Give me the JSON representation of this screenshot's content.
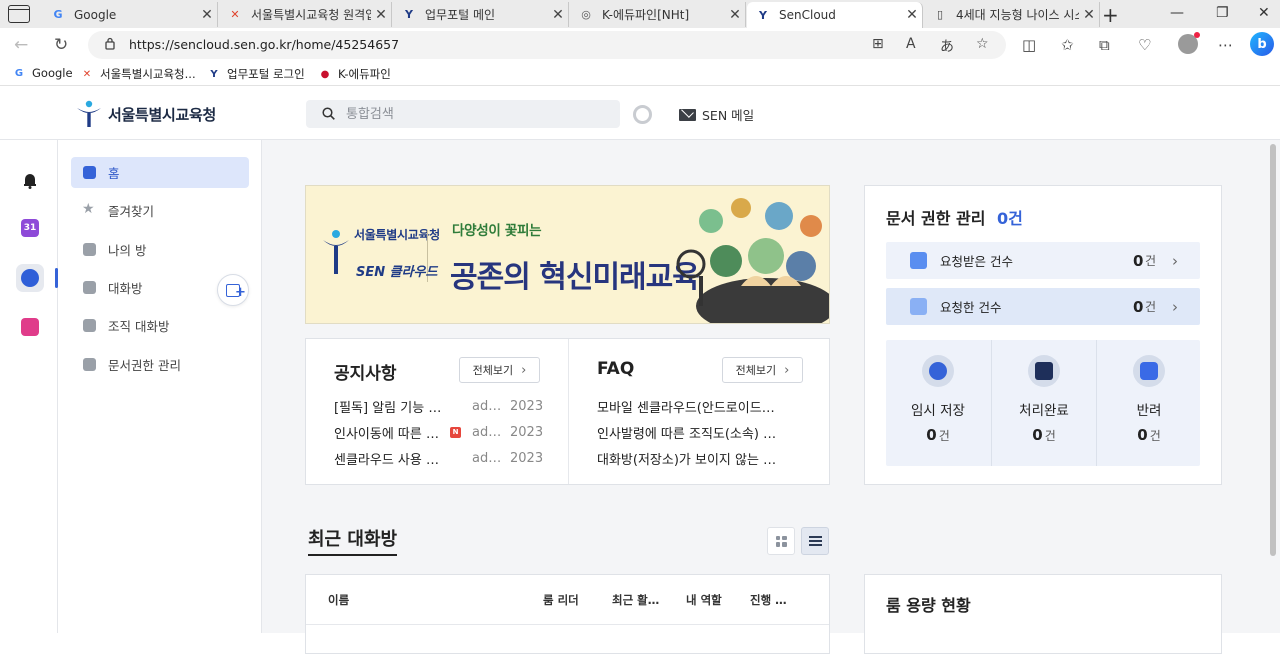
{
  "browser": {
    "tabs": [
      {
        "title": "Google",
        "icon": "google-icon"
      },
      {
        "title": "서울특별시교육청 원격업",
        "icon": "sen-x-icon"
      },
      {
        "title": "업무포털 메인",
        "icon": "sen-logo-icon"
      },
      {
        "title": "K-에듀파인[NHt]",
        "icon": "keduf-icon"
      },
      {
        "title": "SenCloud",
        "icon": "sen-logo-icon"
      },
      {
        "title": "4세대 지능형 나이스 시스",
        "icon": "document-icon"
      }
    ],
    "active_tab": 4,
    "url": "https://sencloud.sen.go.kr/home/45254657",
    "bookmarks": [
      "Google",
      "서울특별시교육청...",
      "업무포털 로그인",
      "K-에듀파인"
    ]
  },
  "app": {
    "org_name": "서울특별시교육청",
    "search_placeholder": "통합검색",
    "mail_label": "SEN 메일",
    "menu": [
      "홈",
      "즐겨찾기",
      "나의 방",
      "대화방",
      "조직 대화방",
      "문서권한 관리"
    ],
    "active_menu": 0,
    "rail_calendar_day": "31"
  },
  "banner": {
    "org": "서울특별시교육청",
    "brand": "SEN 클라우드",
    "subtitle": "다양성이 꽃피는",
    "headline": "공존의 혁신미래교육"
  },
  "notice": {
    "title": "공지사항",
    "view_all": "전체보기",
    "items": [
      {
        "title": "[필독] 알림 기능 개선 안내",
        "author": "admin",
        "date": "2023",
        "is_new": false
      },
      {
        "title": "인사이동에 따른 조직 변경",
        "author": "admin",
        "date": "2023",
        "is_new": true
      },
      {
        "title": "센클라우드 사용 안내",
        "author": "admin",
        "date": "2023",
        "is_new": false
      }
    ],
    "new_badge": "N"
  },
  "faq": {
    "title": "FAQ",
    "view_all": "전체보기",
    "items": [
      "모바일 센클라우드(안드로이드) 설치 방법",
      "인사발령에 따른 조직도(소속) 변경",
      "대화방(저장소)가 보이지 않는 경우"
    ]
  },
  "recent_rooms": {
    "title": "최근 대화방",
    "columns": [
      "이름",
      "룸 리더",
      "최근 활동일",
      "내 역할",
      "진행 상태"
    ]
  },
  "doc_auth": {
    "title": "문서 권한 관리",
    "count": "0건",
    "requests": [
      {
        "label": "요청받은 건수",
        "count": "0",
        "unit": "건"
      },
      {
        "label": "요청한 건수",
        "count": "0",
        "unit": "건"
      }
    ],
    "stats": [
      {
        "label": "임시 저장",
        "count": "0",
        "unit": "건",
        "color": "#3563d8"
      },
      {
        "label": "처리완료",
        "count": "0",
        "unit": "건",
        "color": "#1e2f5a"
      },
      {
        "label": "반려",
        "count": "0",
        "unit": "건",
        "color": "#3a6ae6"
      }
    ]
  },
  "capacity": {
    "title": "룸 용량 현황"
  }
}
